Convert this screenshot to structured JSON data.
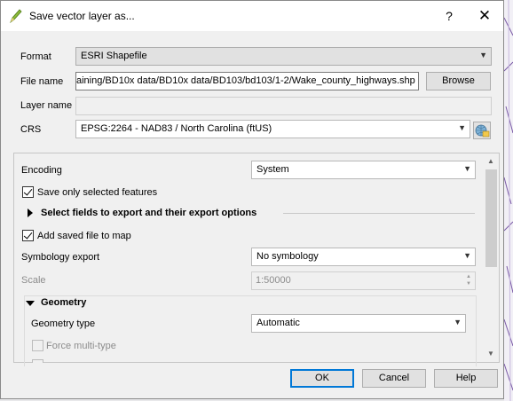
{
  "window": {
    "title": "Save vector layer as...",
    "help_label": "?",
    "close_label": "✕"
  },
  "form": {
    "format_label": "Format",
    "format_value": "ESRI Shapefile",
    "filename_label": "File name",
    "filename_value": "aining/BD10x data/BD10x data/BD103/bd103/1-2/Wake_county_highways.shp",
    "browse_label": "Browse",
    "layername_label": "Layer name",
    "layername_value": "",
    "crs_label": "CRS",
    "crs_value": "EPSG:2264 - NAD83 / North Carolina (ftUS)"
  },
  "options": {
    "encoding_label": "Encoding",
    "encoding_value": "System",
    "save_selected_label": "Save only selected features",
    "save_selected_checked": true,
    "select_fields_label": "Select fields to export and their export options",
    "add_saved_label": "Add saved file to map",
    "add_saved_checked": true,
    "symbology_label": "Symbology export",
    "symbology_value": "No symbology",
    "scale_label": "Scale",
    "scale_value": "1:50000",
    "geometry_group_label": "Geometry",
    "geometry_type_label": "Geometry type",
    "geometry_type_value": "Automatic",
    "force_multi_label": "Force multi-type",
    "force_multi_checked": false
  },
  "buttons": {
    "ok_label": "OK",
    "cancel_label": "Cancel",
    "help_label": "Help"
  },
  "colors": {
    "accent": "#0078d7",
    "map_lines": "#7a5aa6"
  }
}
